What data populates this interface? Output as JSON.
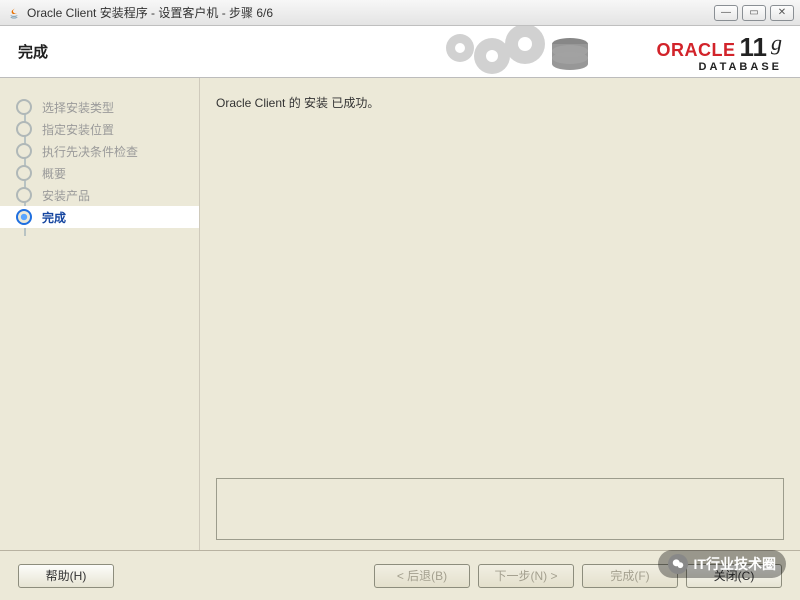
{
  "window": {
    "title": "Oracle Client 安装程序 - 设置客户机 - 步骤 6/6"
  },
  "header": {
    "title": "完成"
  },
  "brand": {
    "oracle": "ORACLE",
    "version_num": "11",
    "version_suffix": "g",
    "database": "DATABASE"
  },
  "steps": {
    "s0": "选择安装类型",
    "s1": "指定安装位置",
    "s2": "执行先决条件检查",
    "s3": "概要",
    "s4": "安装产品",
    "s5": "完成"
  },
  "main": {
    "msg": "Oracle Client 的 安装 已成功。"
  },
  "buttons": {
    "help": "帮助(H)",
    "back": "< 后退(B)",
    "next": "下一步(N) >",
    "finish": "完成(F)",
    "close": "关闭(C)"
  },
  "watermark": {
    "text": "IT行业技术圈"
  }
}
